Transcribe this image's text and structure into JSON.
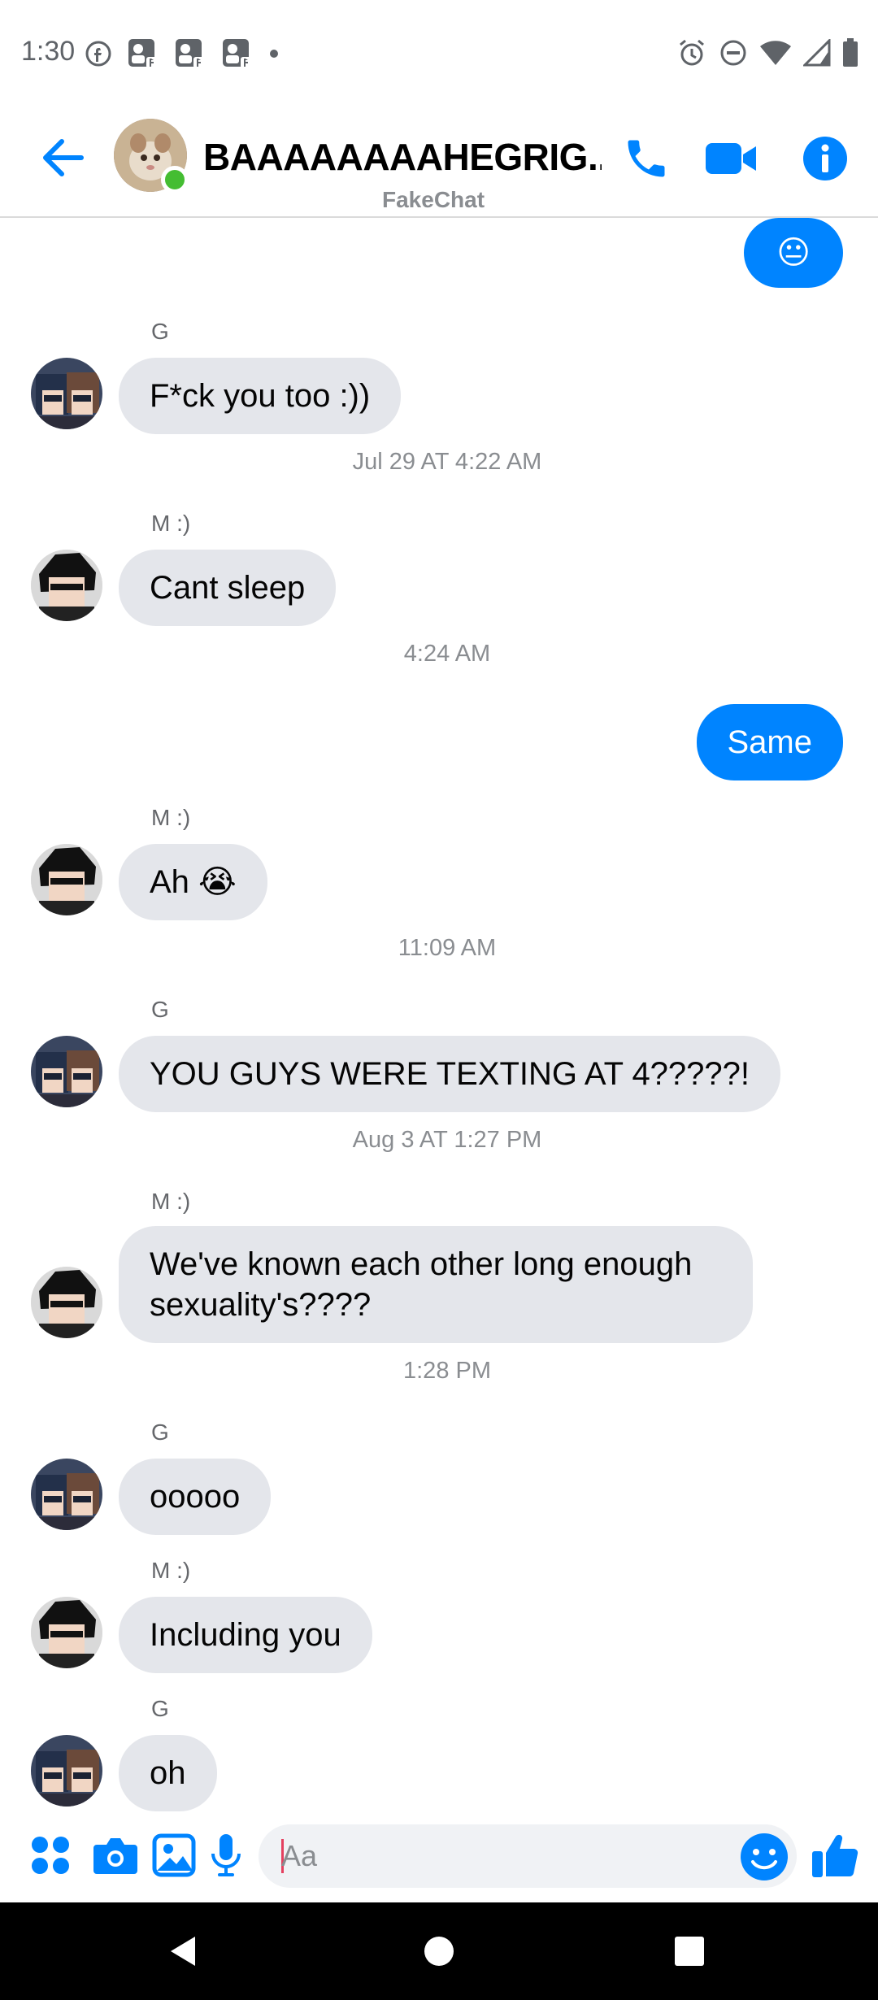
{
  "status_bar": {
    "time": "1:30",
    "left_icons": [
      "facebook-icon",
      "fakechat-notif-icon",
      "fakechat-notif-icon",
      "fakechat-notif-icon",
      "dot-icon"
    ],
    "right_icons": [
      "alarm-icon",
      "dnd-icon",
      "wifi-icon",
      "signal-icon",
      "battery-icon"
    ]
  },
  "header": {
    "contact_name": "BAAAAAAAAHEGRIG...",
    "subtitle": "FakeChat",
    "online": true,
    "accent_color": "#0084ff",
    "actions": [
      "call-icon",
      "video-icon",
      "info-icon"
    ]
  },
  "messages": [
    {
      "type": "outgoing",
      "text": "😐",
      "kind": "emoji"
    },
    {
      "type": "incoming",
      "sender": "G",
      "text": "F*ck you too :))"
    },
    {
      "type": "timestamp",
      "text": "Jul 29 AT 4:22 AM"
    },
    {
      "type": "incoming",
      "sender": "M :)",
      "text": "Cant sleep"
    },
    {
      "type": "timestamp",
      "text": "4:24 AM"
    },
    {
      "type": "outgoing",
      "text": "Same"
    },
    {
      "type": "incoming",
      "sender": "M :)",
      "text": "Ah 😭"
    },
    {
      "type": "timestamp",
      "text": "11:09 AM"
    },
    {
      "type": "incoming",
      "sender": "G",
      "text": "YOU GUYS WERE TEXTING AT 4?????!"
    },
    {
      "type": "timestamp",
      "text": "Aug 3 AT 1:27 PM"
    },
    {
      "type": "incoming",
      "sender": "M :)",
      "text": "We've known each other long enough sexuality's????"
    },
    {
      "type": "timestamp",
      "text": "1:28 PM"
    },
    {
      "type": "incoming",
      "sender": "G",
      "text": "ooooo"
    },
    {
      "type": "incoming",
      "sender": "M :)",
      "text": "Including you"
    },
    {
      "type": "incoming",
      "sender": "G",
      "text": "oh"
    }
  ],
  "composer": {
    "placeholder": "Aa",
    "value": "",
    "icons": [
      "apps-icon",
      "camera-icon",
      "gallery-icon",
      "mic-icon",
      "emoji-icon",
      "like-icon"
    ]
  },
  "colors": {
    "bubble_out": "#0084ff",
    "bubble_in": "#e4e6eb",
    "online": "#44bd32"
  }
}
